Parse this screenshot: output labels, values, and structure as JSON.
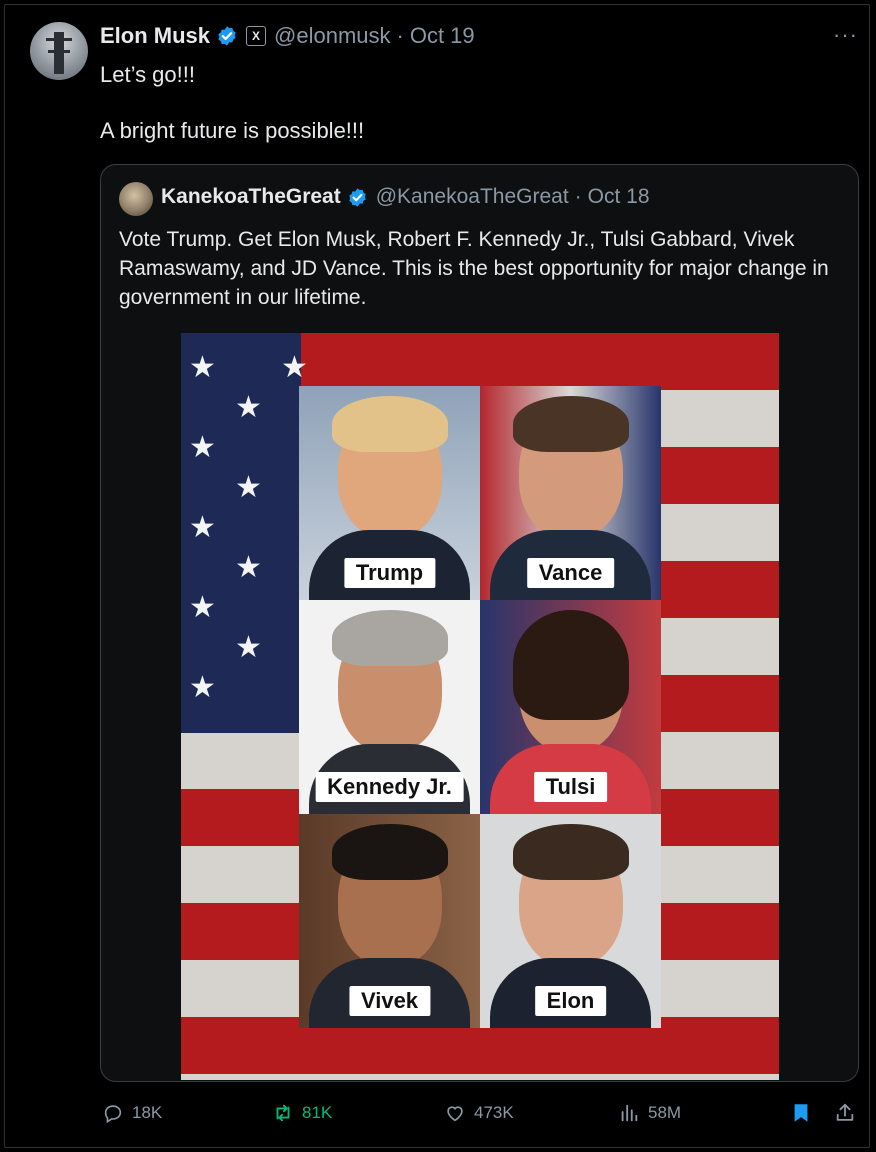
{
  "tweet": {
    "author": {
      "name": "Elon Musk",
      "handle": "@elonmusk",
      "verified": true,
      "affiliate_badge": "X"
    },
    "date": "Oct 19",
    "more_label": "···",
    "lines": [
      "Let’s go!!!",
      "A bright future is possible!!!"
    ]
  },
  "quote": {
    "author": {
      "name": "KanekoaTheGreat",
      "handle": "@KanekoaTheGreat",
      "verified": true
    },
    "date": "Oct 18",
    "text": "Vote Trump. Get Elon Musk, Robert F. Kennedy Jr., Tulsi Gabbard, Vivek Ramaswamy, and JD Vance. This is the best opportunity for major change in government in our lifetime.",
    "image": {
      "panels": [
        {
          "label": "Trump"
        },
        {
          "label": "Vance"
        },
        {
          "label": "Kennedy Jr."
        },
        {
          "label": "Tulsi"
        },
        {
          "label": "Vivek"
        },
        {
          "label": "Elon"
        }
      ]
    }
  },
  "actions": {
    "replies": "18K",
    "reposts": "81K",
    "likes": "473K",
    "views": "58M"
  },
  "colors": {
    "background": "#000000",
    "text": "#e7e9ea",
    "secondary": "#8b98a5",
    "verified": "#1d9bf0",
    "repost_active": "#00ba7c",
    "bookmark_active": "#1d9bf0"
  },
  "icons": [
    "verified-icon",
    "x-badge-icon",
    "more-icon",
    "reply-icon",
    "repost-icon",
    "like-icon",
    "views-icon",
    "bookmark-icon",
    "share-icon"
  ]
}
